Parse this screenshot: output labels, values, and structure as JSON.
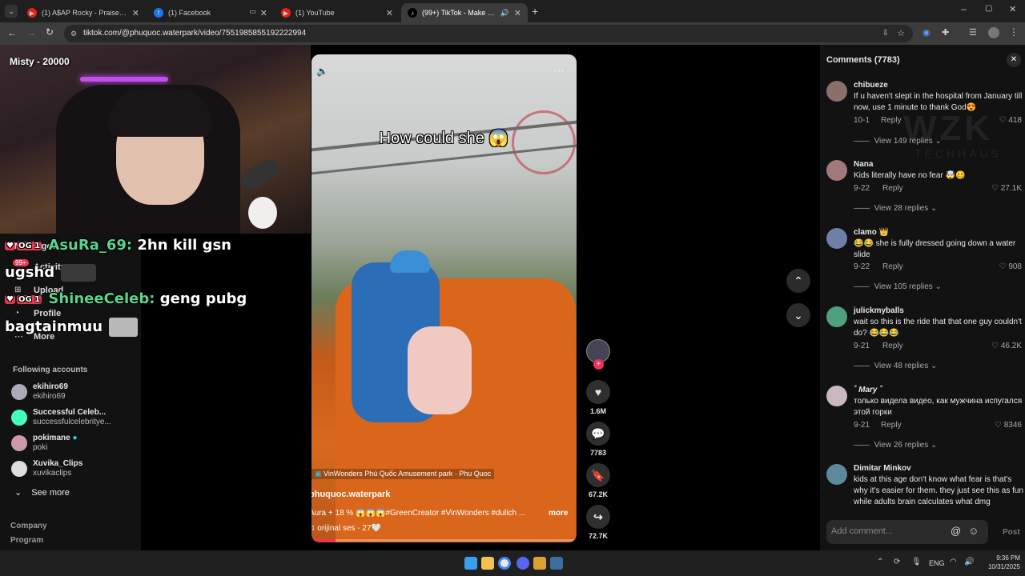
{
  "browser": {
    "tabs": [
      {
        "title": "(1) A$AP Rocky - Praise The Lo",
        "icon": "youtube-icon"
      },
      {
        "title": "(1) Facebook",
        "icon": "facebook-icon"
      },
      {
        "title": "(1) YouTube",
        "icon": "youtube-icon"
      },
      {
        "title": "(99+) TikTok - Make Your Da",
        "icon": "tiktok-icon"
      }
    ],
    "url": "tiktok.com/@phuquoc.waterpark/video/7551985855192222994"
  },
  "stream": {
    "streamer_label": "Misty - 20000",
    "chat": [
      {
        "badge": "OG 1",
        "nick": "AsuRa_69:",
        "text": "2hn kill gsn",
        "cont": "ugshd"
      },
      {
        "badge": "OG 1",
        "nick": "ShineeCeleb:",
        "text": "geng pubg",
        "cont": "bagtainmuu"
      }
    ]
  },
  "sidebar": {
    "nav": [
      "Messages",
      "Activity",
      "Upload",
      "Profile",
      "More"
    ],
    "activity_badge": "99+",
    "following_title": "Following accounts",
    "following": [
      {
        "name": "ekihiro69",
        "handle": "ekihiro69"
      },
      {
        "name": "Successful Celeb...",
        "handle": "successfulcelebritye..."
      },
      {
        "name": "pokimane",
        "handle": "poki"
      },
      {
        "name": "Xuvika_Clips",
        "handle": "xuvikaclips"
      }
    ],
    "see_more": "See more",
    "footer": [
      "Company",
      "Program"
    ]
  },
  "video": {
    "overlay_text": "How could she 😱",
    "location": "VinWonders Phú Quốc Amusement park · Phu Quoc",
    "author": "phuquoc.waterpark",
    "caption": "Aura + 18 % 😱😱😱#GreenCreator #VinWonders #dulich ...",
    "more": "more",
    "sound": "orijinal ses - 27🤍",
    "likes": "1.6M",
    "comments": "7783",
    "saves": "67.2K",
    "shares": "72.7K"
  },
  "comments_panel": {
    "title": "Comments (7783)",
    "reply_label": "Reply",
    "items": [
      {
        "user": "chibueze",
        "text": "If u haven't slept in the hospital from January till now, use 1 minute to thank God😍",
        "date": "10-1",
        "likes": "418",
        "view": "View 149 replies"
      },
      {
        "user": "Nana",
        "text": "Kids literally have no fear 🤯🥴",
        "date": "9-22",
        "likes": "27.1K",
        "view": "View 28 replies"
      },
      {
        "user": "clamo 👑",
        "text": "😂😂 she is fully dressed going down a water slide",
        "date": "9-22",
        "likes": "908",
        "view": "View 105 replies"
      },
      {
        "user": "julickmyballs",
        "text": "wait so this is the ride that that one guy couldn't do? 😂😂😂",
        "date": "9-21",
        "likes": "46.2K",
        "view": "View 48 replies"
      },
      {
        "user": "˚ Mary ˚",
        "text": "только видела видео, как мужчина испугался этой горки",
        "date": "9-21",
        "likes": "8346",
        "view": "View 26 replies"
      },
      {
        "user": "Dimitar Minkov",
        "text": "kids at this age don't know what fear is that's why it's easier for them. they just see this as fun while adults brain calculates what dmg",
        "date": "",
        "likes": "",
        "view": ""
      }
    ],
    "add_placeholder": "Add comment...",
    "post": "Post"
  },
  "watermark": {
    "big": "WZK",
    "small": "TECHHAUS"
  },
  "taskbar": {
    "lang": "ENG",
    "time": "9:36 PM",
    "date": "10/31/2025"
  }
}
